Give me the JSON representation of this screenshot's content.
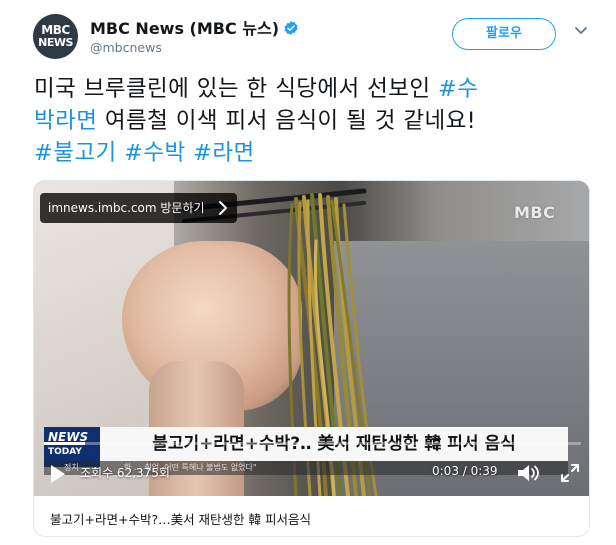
{
  "account": {
    "avatar_line1": "MBC",
    "avatar_line2": "NEWS",
    "name": "MBC News (MBC 뉴스)",
    "handle": "@mbcnews",
    "verified": true
  },
  "follow_button": {
    "label": "팔로우"
  },
  "tweet": {
    "lines": [
      [
        {
          "text": "미국 브루클린에 있는 한 식당에서 선보인 ",
          "hashtag": false
        },
        {
          "text": "#수",
          "hashtag": true
        }
      ],
      [
        {
          "text": "박라면",
          "hashtag": true
        },
        {
          "text": " 여름철 이색 피서 음식이 될 것 같네요!",
          "hashtag": false
        }
      ],
      [
        {
          "text": "#불고기",
          "hashtag": true
        },
        {
          "text": " ",
          "hashtag": false
        },
        {
          "text": "#수박",
          "hashtag": true
        },
        {
          "text": " ",
          "hashtag": false
        },
        {
          "text": "#라면",
          "hashtag": true
        }
      ]
    ]
  },
  "video_card": {
    "visit_label": "imnews.imbc.com 방문하기",
    "watermark": "MBC",
    "news_badge_line1": "NEWS",
    "news_badge_line2": "TODAY",
    "headline": "불고기+라면+수박?‥ 美서 재탄생한 韓 피서 음식",
    "subtitle_left": "정치",
    "subtitle_right": "한 … 취업, 어떤 특혜나 불법도 없었다\"",
    "views": "조회수 62,375회",
    "time": "0:03 / 0:39",
    "progress_fraction": 0.077,
    "card_title": "불고기+라면+수박?…美서 재탄생한 韓 피서음식"
  },
  "colors": {
    "accent": "#1da1f2",
    "hashtag": "#1b95e0",
    "handle_gray": "#657786",
    "badge_blue": "#0f2f6e"
  },
  "icons": {
    "verified": "verified-badge-icon",
    "caret": "chevron-down-icon",
    "visit": "chevron-right-icon",
    "play": "play-icon",
    "volume": "volume-icon",
    "fullscreen": "fullscreen-icon"
  }
}
